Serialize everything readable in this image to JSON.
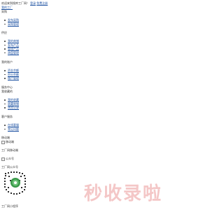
{
  "header": {
    "welcome": "欢迎来到搜库工厂网！",
    "login": "登录",
    "register": "免费注册",
    "my_factory": "我的工厂"
  },
  "sections": {
    "purchase": {
      "title": "采购",
      "items": [
        "发布采购",
        "采购管理"
      ]
    },
    "supply": {
      "title": "供应",
      "items": [
        "我的商铺",
        "发布产品",
        "管理产品",
        "询盘管理"
      ]
    },
    "account": {
      "title": "我的账户",
      "items": [
        "资金余额",
        "积分余额",
        "账户管理"
      ]
    },
    "favorites": {
      "title1": "服务中心",
      "title2": "我收藏的",
      "items": [
        "我的收藏",
        "收藏商铺",
        "浏览记录"
      ]
    },
    "customer": {
      "title": "客户服务",
      "items": [
        "在线客服",
        "常见问题"
      ]
    },
    "mobile": {
      "title": "移动端",
      "img_alt": "移动端"
    },
    "mobile_factory": {
      "title": "工厂网移动端",
      "img_alt": "公众号"
    },
    "official": {
      "title": "工厂网公众号",
      "footer": "工厂网小程序"
    }
  },
  "watermark": "秒收录啦",
  "colors": {
    "link": "#1a4fa0",
    "watermark": "#f4c7c7"
  }
}
